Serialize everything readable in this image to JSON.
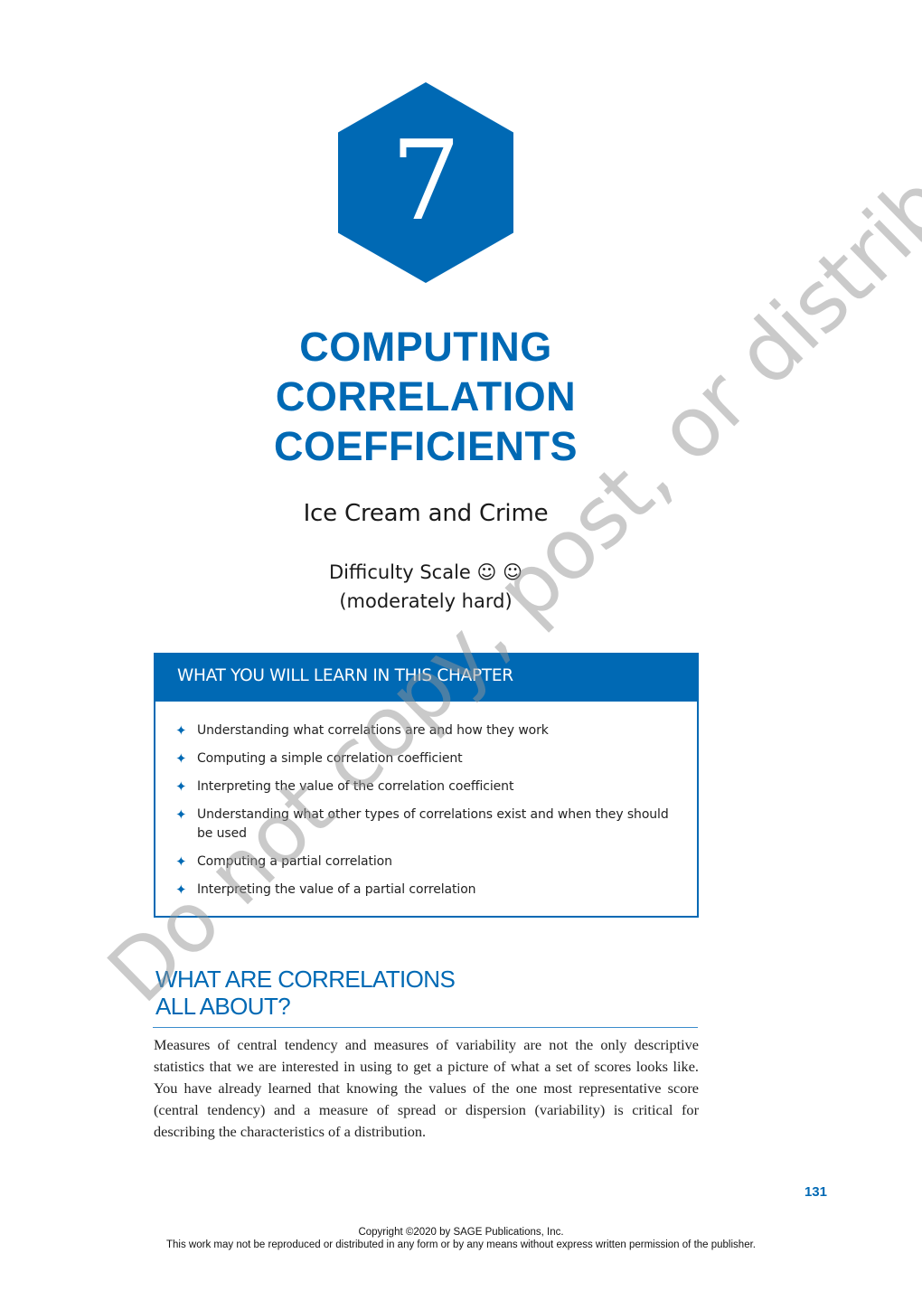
{
  "chapter": {
    "number": "7",
    "title_lines": [
      "COMPUTING",
      "CORRELATION",
      "COEFFICIENTS"
    ],
    "subtitle": "Ice Cream and Crime",
    "difficulty_label": "Difficulty Scale ☺ ☺",
    "difficulty_note": "(moderately hard)",
    "difficulty_icons": [
      "smiley-icon",
      "smiley-icon"
    ]
  },
  "learn_box": {
    "header": "WHAT YOU WILL LEARN IN THIS CHAPTER",
    "bullet_glyph": "✦",
    "items": [
      "Understanding what correlations are and how they work",
      "Computing a simple correlation coefficient",
      "Interpreting the value of the correlation coefficient",
      "Understanding what other types of correlations exist and when they should be used",
      "Computing a partial correlation",
      "Interpreting the value of a partial correlation"
    ]
  },
  "section": {
    "heading_line1": "WHAT ARE CORRELATIONS",
    "heading_line2": "ALL ABOUT?",
    "body": "Measures of central tendency and measures of variability are not the only descriptive statistics that we are interested in using to get a picture of what a set of scores looks like. You have already learned that knowing the values of the one most representative score (central tendency) and a measure of spread or dispersion (variability) is critical for describing the characteristics of a distribution."
  },
  "page_number": "131",
  "footer": {
    "copyright": "Copyright ©2020 by SAGE Publications, Inc.",
    "notice": "This work may not be reproduced or distributed in any form or by any means without express written permission of the publisher."
  },
  "watermark": "Do not copy, post, or distribute",
  "colors": {
    "brand_blue": "#0069b4",
    "watermark_gray": "#969696"
  }
}
